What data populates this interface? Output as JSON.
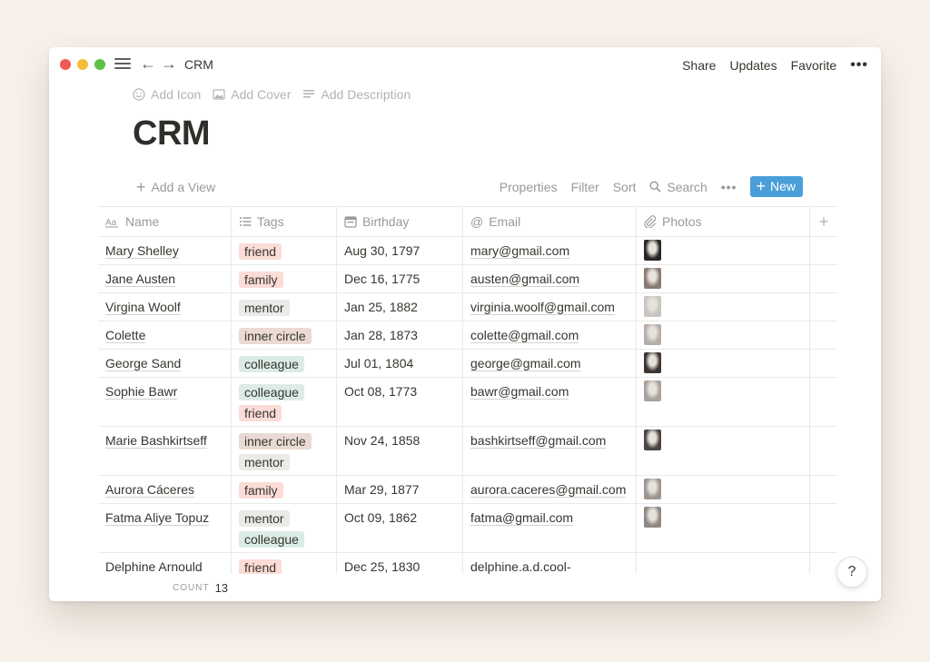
{
  "window": {
    "breadcrumb": "CRM",
    "actions": {
      "share": "Share",
      "updates": "Updates",
      "favorite": "Favorite",
      "more": "•••"
    }
  },
  "page": {
    "title": "CRM",
    "add_icon": "Add Icon",
    "add_cover": "Add Cover",
    "add_description": "Add Description"
  },
  "viewbar": {
    "add_view": "Add a View",
    "properties": "Properties",
    "filter": "Filter",
    "sort": "Sort",
    "search": "Search",
    "more": "•••",
    "new": "New"
  },
  "table": {
    "columns": {
      "name": "Name",
      "tags": "Tags",
      "birthday": "Birthday",
      "email": "Email",
      "photos": "Photos",
      "add": "+"
    },
    "tag_colors": {
      "friend": "#fbdcd6",
      "family": "#fbdcd6",
      "mentor": "#ebeae8",
      "inner circle": "#eadad3",
      "colleague": "#dbece6"
    },
    "rows": [
      {
        "name": "Mary Shelley",
        "tags": [
          "friend"
        ],
        "birthday": "Aug 30, 1797",
        "email": "mary@gmail.com",
        "photo": true
      },
      {
        "name": "Jane Austen",
        "tags": [
          "family"
        ],
        "birthday": "Dec 16, 1775",
        "email": "austen@gmail.com",
        "photo": true
      },
      {
        "name": "Virgina Woolf",
        "tags": [
          "mentor"
        ],
        "birthday": "Jan 25, 1882",
        "email": "virginia.woolf@gmail.com",
        "photo": true
      },
      {
        "name": "Colette",
        "tags": [
          "inner circle"
        ],
        "birthday": "Jan 28, 1873",
        "email": "colette@gmail.com",
        "photo": true
      },
      {
        "name": "George Sand",
        "tags": [
          "colleague"
        ],
        "birthday": "Jul 01, 1804",
        "email": "george@gmail.com",
        "photo": true
      },
      {
        "name": "Sophie Bawr",
        "tags": [
          "colleague",
          "friend"
        ],
        "birthday": "Oct 08, 1773",
        "email": "bawr@gmail.com",
        "photo": true
      },
      {
        "name": "Marie Bashkirtseff",
        "tags": [
          "inner circle",
          "mentor"
        ],
        "birthday": "Nov 24, 1858",
        "email": "bashkirtseff@gmail.com",
        "photo": true
      },
      {
        "name": "Aurora Cáceres",
        "tags": [
          "family"
        ],
        "birthday": "Mar 29, 1877",
        "email": "aurora.caceres@gmail.com",
        "photo": true
      },
      {
        "name": "Fatma Aliye Topuz",
        "tags": [
          "mentor",
          "colleague"
        ],
        "birthday": "Oct 09, 1862",
        "email": "fatma@gmail.com",
        "photo": true
      },
      {
        "name": "Delphine Arnould",
        "tags": [
          "friend"
        ],
        "birthday": "Dec 25, 1830",
        "email": "delphine.a.d.cool-",
        "photo": false
      }
    ]
  },
  "footer": {
    "count_label": "COUNT",
    "count_value": "13"
  },
  "help": {
    "label": "?"
  }
}
